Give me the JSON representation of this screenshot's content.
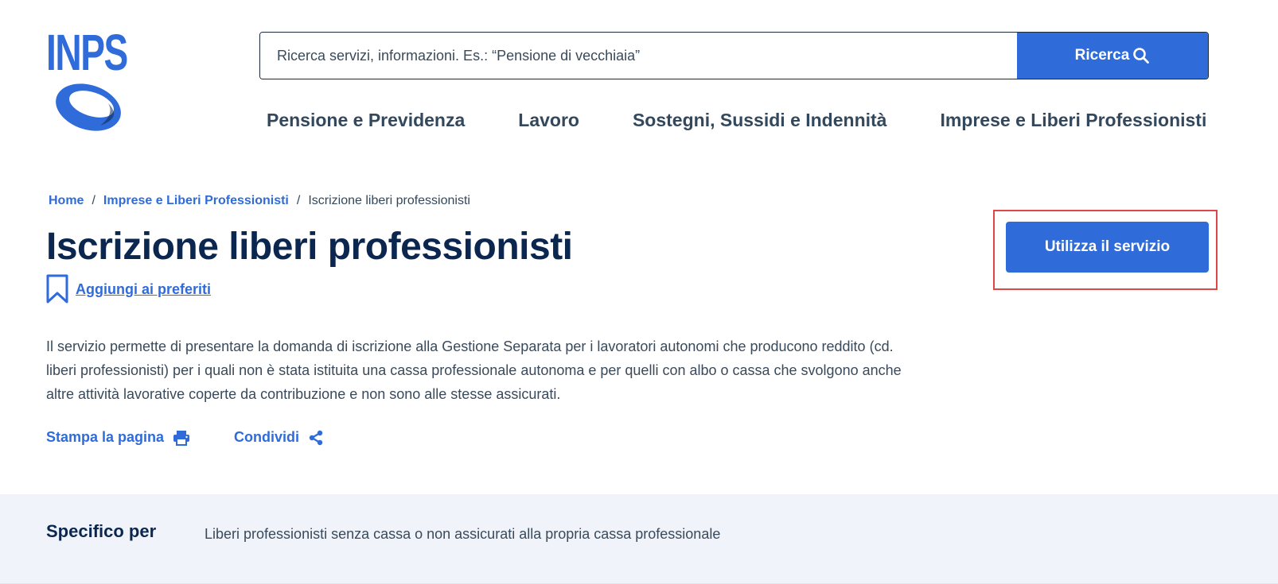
{
  "header": {
    "logo_text": "INPS",
    "search": {
      "placeholder": "Ricerca servizi, informazioni. Es.: “Pensione di vecchiaia”",
      "button_label": "Ricerca"
    },
    "nav": [
      {
        "label": "Pensione e Previdenza"
      },
      {
        "label": "Lavoro"
      },
      {
        "label": "Sostegni, Sussidi e Indennità"
      },
      {
        "label": "Imprese e Liberi Professionisti"
      }
    ]
  },
  "breadcrumb": {
    "items": [
      {
        "label": "Home"
      },
      {
        "label": "Imprese e Liberi Professionisti"
      }
    ],
    "separator": "/",
    "current": "Iscrizione liberi professionisti"
  },
  "page": {
    "title": "Iscrizione liberi professionisti",
    "favorite_label": "Aggiungi ai preferiti",
    "cta_label": "Utilizza il servizio",
    "description": "Il servizio permette di presentare la domanda di iscrizione alla Gestione Separata per i lavoratori autonomi che producono reddito (cd. liberi professionisti) per i quali non è stata istituita una cassa professionale autonoma e per quelli con albo o cassa che svolgono anche altre attività lavorative coperte da contribuzione e non sono alle stesse assicurati.",
    "actions": {
      "print_label": "Stampa la pagina",
      "share_label": "Condividi"
    }
  },
  "specific": {
    "label": "Specifico per",
    "value": "Liberi professionisti senza cassa o non assicurati alla propria cassa professionale"
  },
  "colors": {
    "brand_blue": "#2f6bd9",
    "title_navy": "#0b2750",
    "highlight_red": "#e04646",
    "band_bg": "#f0f4fa"
  }
}
